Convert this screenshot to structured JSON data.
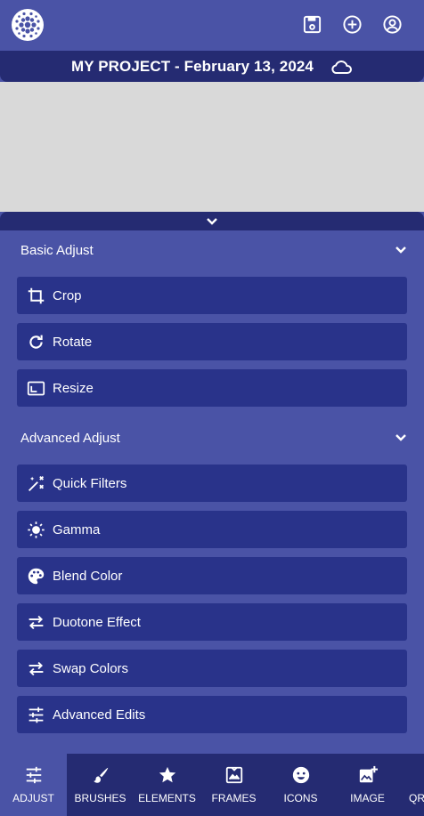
{
  "header": {
    "icons": [
      "save-icon",
      "add-circle-icon",
      "account-icon"
    ]
  },
  "project": {
    "title": "MY PROJECT - February 13, 2024"
  },
  "panel": {
    "sections": [
      {
        "title": "Basic Adjust",
        "items": [
          {
            "label": "Crop",
            "icon": "crop-icon"
          },
          {
            "label": "Rotate",
            "icon": "rotate-icon"
          },
          {
            "label": "Resize",
            "icon": "resize-icon"
          }
        ]
      },
      {
        "title": "Advanced Adjust",
        "items": [
          {
            "label": "Quick Filters",
            "icon": "magic-wand-icon"
          },
          {
            "label": "Gamma",
            "icon": "sun-icon"
          },
          {
            "label": "Blend Color",
            "icon": "palette-icon"
          },
          {
            "label": "Duotone Effect",
            "icon": "swap-horizontal-icon"
          },
          {
            "label": "Swap Colors",
            "icon": "swap-horizontal-icon"
          },
          {
            "label": "Advanced Edits",
            "icon": "tune-icon"
          }
        ]
      }
    ]
  },
  "bottom_nav": {
    "active": "ADJUST",
    "items": [
      {
        "label": "ADJUST",
        "icon": "tune-icon"
      },
      {
        "label": "BRUSHES",
        "icon": "brush-icon"
      },
      {
        "label": "ELEMENTS",
        "icon": "star-icon"
      },
      {
        "label": "FRAMES",
        "icon": "frame-icon"
      },
      {
        "label": "ICONS",
        "icon": "smiley-icon"
      },
      {
        "label": "IMAGE",
        "icon": "add-image-icon"
      },
      {
        "label": "QR",
        "icon": "qr-icon"
      }
    ]
  },
  "colors": {
    "panel_bg": "#4a53a6",
    "dark_bar": "#252b72",
    "button_bg": "#29338a",
    "canvas_bg": "#d9d9d9"
  }
}
